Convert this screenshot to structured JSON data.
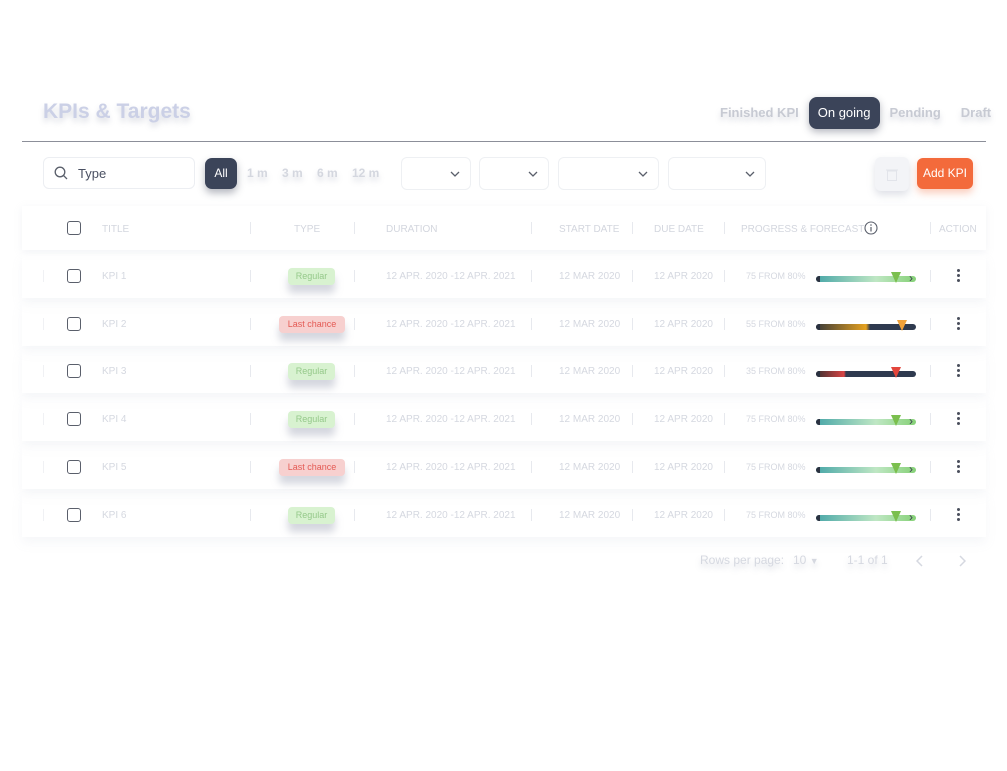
{
  "header": {
    "title": "KPIs & Targets",
    "tabs": [
      {
        "label": "Finished KPI",
        "active": false
      },
      {
        "label": "On going",
        "active": true
      },
      {
        "label": "Pending",
        "active": false
      },
      {
        "label": "Draft",
        "active": false
      }
    ]
  },
  "toolbar": {
    "search_placeholder": "Type",
    "filters": [
      "All",
      "1 m",
      "3 m",
      "6 m",
      "12 m"
    ],
    "add_label": "Add KPI"
  },
  "table": {
    "columns": [
      "TITLE",
      "TYPE",
      "DURATION",
      "START DATE",
      "DUE DATE",
      "PROGRESS & FORECAST",
      "ACTION"
    ],
    "rows": [
      {
        "title": "KPI 1",
        "type": "Regular",
        "type_kind": "regular",
        "duration": "12 APR. 2020 -12 APR. 2021",
        "start": "12 MAR 2020",
        "due": "12 APR 2020",
        "progress_text": "75 FROM 80%",
        "progress": 75,
        "forecast": 80,
        "status": "green"
      },
      {
        "title": "KPI 2",
        "type": "Last chance",
        "type_kind": "last",
        "duration": "12 APR. 2020 -12 APR. 2021",
        "start": "12 MAR 2020",
        "due": "12 APR 2020",
        "progress_text": "55 FROM 80%",
        "progress": 55,
        "forecast": 86,
        "status": "orange"
      },
      {
        "title": "KPI 3",
        "type": "Regular",
        "type_kind": "regular",
        "duration": "12 APR. 2020 -12 APR. 2021",
        "start": "12 MAR 2020",
        "due": "12 APR 2020",
        "progress_text": "35 FROM 80%",
        "progress": 28,
        "forecast": 80,
        "status": "red"
      },
      {
        "title": "KPI 4",
        "type": "Regular",
        "type_kind": "regular",
        "duration": "12 APR. 2020 -12 APR. 2021",
        "start": "12 MAR 2020",
        "due": "12 APR 2020",
        "progress_text": "75 FROM 80%",
        "progress": 75,
        "forecast": 80,
        "status": "green"
      },
      {
        "title": "KPI 5",
        "type": "Last chance",
        "type_kind": "last",
        "duration": "12 APR. 2020 -12 APR. 2021",
        "start": "12 MAR 2020",
        "due": "12 APR 2020",
        "progress_text": "75 FROM 80%",
        "progress": 75,
        "forecast": 80,
        "status": "green"
      },
      {
        "title": "KPI 6",
        "type": "Regular",
        "type_kind": "regular",
        "duration": "12 APR. 2020 -12 APR. 2021",
        "start": "12 MAR 2020",
        "due": "12 APR 2020",
        "progress_text": "75 FROM 80%",
        "progress": 75,
        "forecast": 80,
        "status": "green"
      }
    ]
  },
  "pagination": {
    "rows_label": "Rows per page:",
    "rows_value": "10",
    "range": "1-1 of 1"
  },
  "colors": {
    "accent_dark": "#3b4459",
    "accent_orange": "#f36a3b",
    "badge_regular": "#d8f2d0",
    "badge_last": "#f7d0cf"
  }
}
